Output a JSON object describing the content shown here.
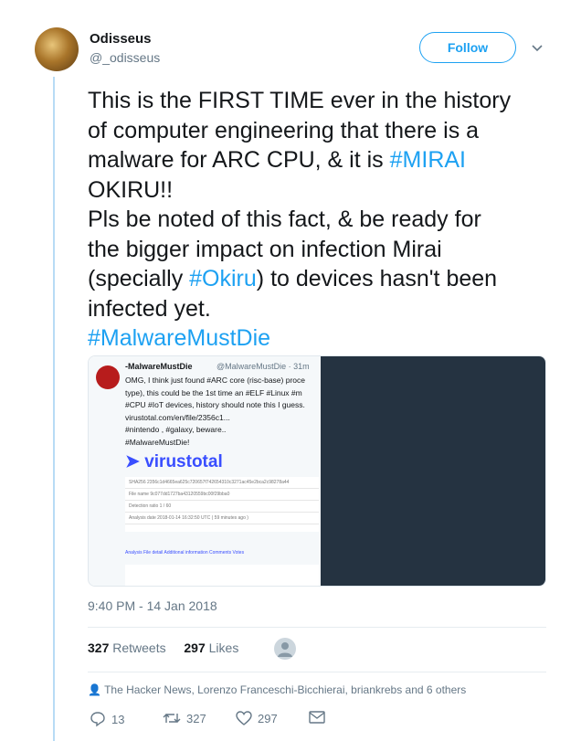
{
  "author": {
    "name": "Odisseus",
    "handle": "@_odisseus"
  },
  "follow_label": "Follow",
  "tweet": {
    "line1": "This is the FIRST TIME ever in the history\nof computer engineering  that there is a\nmalware for ARC CPU, & it is ",
    "tag1": "#MIRAI",
    "line2": "\nOKIRU!!\nPls be noted of this fact, & be ready for\nthe bigger impact on infection Mirai\n(specially ",
    "tag2": "#Okiru",
    "line3": ") to devices hasn't been\ninfected yet.\n",
    "tag3": "#MalwareMustDie"
  },
  "media": {
    "quoted_name": "-MalwareMustDie",
    "quoted_handle": "@MalwareMustDie · 31m",
    "quoted_text": "OMG, I think just found #ARC core (risc-base) proce\ntype), this could be the 1st time an #ELF #Linux #m\n#CPU #IoT devices, history should note this I guess.\nvirustotal.com/en/file/2356c1...\n#nintendo , #galaxy, beware..\n#MalwareMustDie!",
    "vt_logo": "virustotal",
    "vt_rows": [
      "SHA256   2356c1d4665ea625c720657f742654310c3271ac45e2bca2c98278a44",
      "File name   9c077dd1727ba43120559bc00f29bba0",
      "Detection ratio   1 / 60",
      "Analysis date   2018-01-14 16:32:50 UTC ( 59 minutes ago )"
    ],
    "vt_tabs": "Analysis     File detail     Additional information     Comments     Votes"
  },
  "timestamp": "9:40 PM - 14 Jan 2018",
  "stats": {
    "retweets_count": "327",
    "retweets_label": "Retweets",
    "likes_count": "297",
    "likes_label": "Likes"
  },
  "social_context": "The Hacker News, Lorenzo Franceschi-Bicchierai, briankrebs and 6 others",
  "actions": {
    "replies": "13",
    "retweets": "327",
    "likes": "297"
  },
  "colors": {
    "accent": "#1da1f2",
    "thread_line": "#b8dbf5",
    "muted": "#657786"
  }
}
